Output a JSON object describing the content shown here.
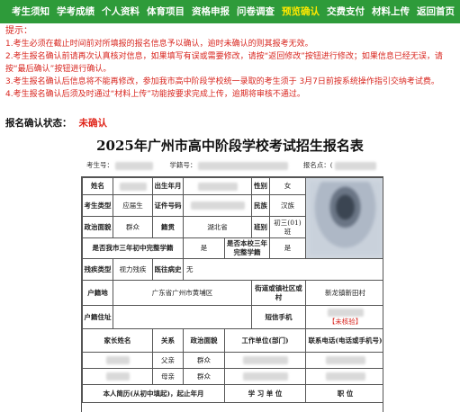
{
  "nav": {
    "items": [
      "考生须知",
      "学考成绩",
      "个人资料",
      "体育项目",
      "资格申报",
      "问卷调查",
      "预览确认",
      "交费支付",
      "材料上传",
      "返回首页"
    ],
    "active_index": 6,
    "colors": {
      "bar": "#2e9b3a",
      "active": "#ffe800"
    }
  },
  "notice": {
    "title": "提示：",
    "lines": [
      "1.考生必须在截止时间前对所填报的报名信息予以确认，逾时未确认的则其报考无效。",
      "2.考生报名确认前请再次认真核对信息，如果填写有误或需要修改，请按“返回修改”按钮进行修改；如果信息已经无误，请按“最后确认”按钮进行确认。",
      "3.考生报名确认后信息将不能再修改，参加我市高中阶段学校统一录取的考生须于 3月7日前按系统操作指引交纳考试费。",
      "4.考生报名确认后须及时通过“材料上传”功能按要求完成上传，逾期将审核不通过。"
    ]
  },
  "status": {
    "label": "报名确认状态：",
    "value": "未确认"
  },
  "form": {
    "title": "2025年广州市高中阶段学校考试招生报名表",
    "meta": {
      "exam_no_label": "考生号：",
      "student_no_label": "学籍号：",
      "reg_point_label": "报名点：",
      "reg_point_value": "("
    },
    "rows": {
      "name": "姓名",
      "birth": "出生年月",
      "gender": "性别",
      "gender_value": "女",
      "type": "考生类型",
      "type_value": "应届生",
      "id_no": "证件号码",
      "ethnic": "民族",
      "ethnic_value": "汉族",
      "politics": "政治面貌",
      "politics_value": "群众",
      "native": "籍贯",
      "native_value": "湖北省",
      "class": "班别",
      "class_value": "初三(01)班",
      "complete_city": "是否我市三年初中完整学籍",
      "complete_city_value": "是",
      "complete_school": "是否本校三年完整学籍",
      "complete_school_value": "是",
      "disability": "残疾类型",
      "disability_value": "视力残疾",
      "history": "既往病史",
      "history_value": "无",
      "hukou": "户籍地",
      "hukou_value": "广东省广州市黄埔区",
      "street": "街道或镇社区或村",
      "street_value": "新龙镇新田村",
      "address": "户籍住址",
      "sms": "短信手机",
      "sms_status": "【未核验】",
      "family_name": "家长姓名",
      "relation": "关系",
      "family_politics": "政治面貌",
      "work": "工作单位(部门)",
      "contact": "联系电话(电话或手机号)",
      "family": [
        {
          "relation": "父亲",
          "politics": "群众"
        },
        {
          "relation": "母亲",
          "politics": "群众"
        }
      ],
      "resume": "本人简历(从初中填起)，起止年月",
      "resume_school": "学 习 单 位",
      "resume_role": "职 位"
    }
  }
}
